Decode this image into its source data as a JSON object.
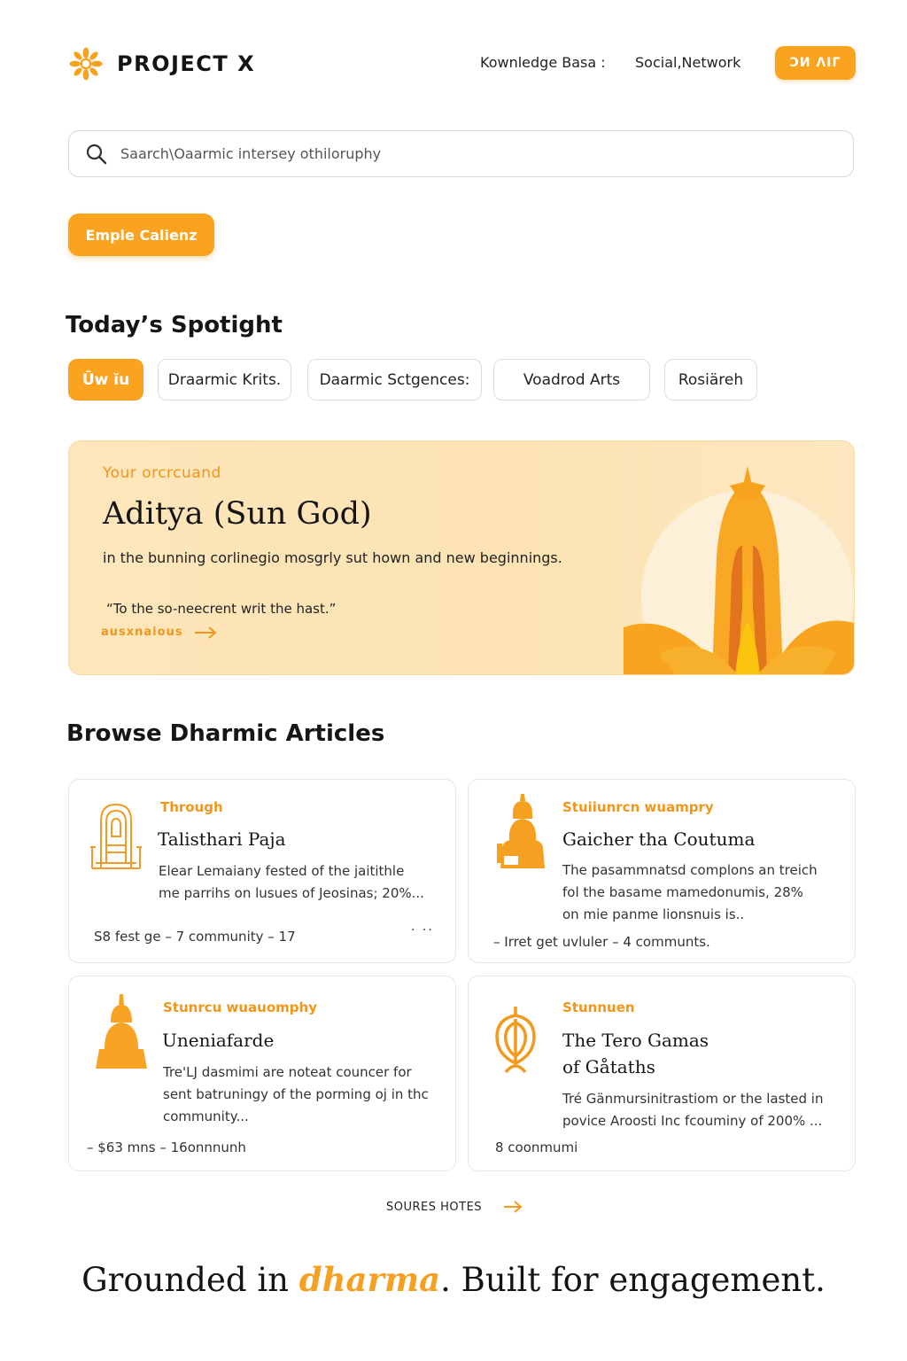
{
  "header": {
    "brand": "PROJECT X",
    "nav": [
      {
        "label": "Kownledge Basa :"
      },
      {
        "label": "Social,Network"
      }
    ],
    "join_label": "ƆИ ΛIΓ"
  },
  "search": {
    "placeholder": "Saarch\\Oaarmic intersey othiloruphy"
  },
  "primary_button": "Emple Calienz",
  "spotlight": {
    "section_title": "Today’s Spotight",
    "chips": [
      {
        "label": "Ūw ĭu",
        "active": true
      },
      {
        "label": "Draarmic Krits.",
        "active": false
      },
      {
        "label": "Daarmic Sctgences:",
        "active": false
      },
      {
        "label": "Voadrod Arts",
        "active": false
      },
      {
        "label": "Rosiäreh",
        "active": false
      }
    ],
    "card": {
      "kicker": "Your orcrcuand",
      "title": "Aditya (Sun God)",
      "description": "in the bunning corlinegio mosgrly sut hown and new beginnings.",
      "quote": "“To the so-neecrent writ the hast.”",
      "link": "ausxnaious"
    }
  },
  "articles": {
    "section_title": "Browse Dharmic Articles",
    "items": [
      {
        "category": "Through",
        "title": "Talisthari Paja",
        "description_lines": [
          "Elear Lemaiany fested of the jaitithle",
          "me parrihs on lusues of Jeosinas; 20%..."
        ],
        "meta": "S8 fest ge – 7  community  – 17",
        "more": "· ··",
        "icon": "temple-gate-icon"
      },
      {
        "category": "Stuiiunrcn wuampry",
        "title": "Gaicher tha Coutuma",
        "description_lines": [
          "The pasammnatsd complons an treich",
          "fol the basame mamedonumis, 28%",
          "on mie panme lionsnuis is.."
        ],
        "meta": "– Irret get uvluler – 4 communts.",
        "icon": "seated-deity-icon"
      },
      {
        "category": "Stunrcu wuauomphy",
        "title": "Uneniafarde",
        "description_lines": [
          "Tre'LJ dasmimi are noteat councer for",
          "sent batruningy of the porming oj in thc",
          "community..."
        ],
        "meta": "– $63 mns  – 16onnnunh",
        "icon": "stupa-icon"
      },
      {
        "category": "Stunnuen",
        "title_lines": [
          "The Tero Gamas",
          "of Gåtaths"
        ],
        "description_lines": [
          "Tré Gänmursinitrastiom or the lasted in",
          "povice Aroosti Inc fcouminy of 200% ..."
        ],
        "meta": "8 coonmumi",
        "icon": "khanda-icon"
      }
    ]
  },
  "more_link": "SOURES HOTES",
  "tagline": {
    "before": "Grounded in ",
    "accent": "dharma",
    "after": ". Built for engagement."
  },
  "colors": {
    "accent": "#f9a31f",
    "card_background": "#fde4b6",
    "text": "#141414"
  }
}
